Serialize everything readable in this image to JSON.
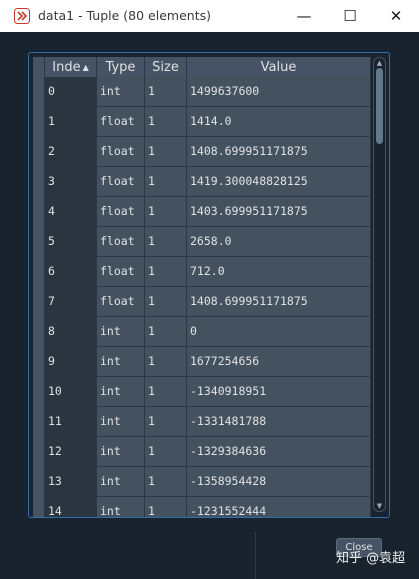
{
  "window": {
    "title": "data1 - Tuple (80 elements)",
    "minimize_glyph": "—",
    "maximize_glyph": "☐",
    "close_glyph": "✕"
  },
  "background_editor": {
    "snippet_lines": [
      "6",
      "汶",
      "i",
      "c",
      "ll"
    ],
    "right_snippet": "ll"
  },
  "table": {
    "headers": {
      "index": "Inde",
      "type": "Type",
      "size": "Size",
      "value": "Value"
    },
    "sort_indicator": "▲",
    "rows": [
      {
        "index": "0",
        "type": "int",
        "size": "1",
        "value": "1499637600"
      },
      {
        "index": "1",
        "type": "float",
        "size": "1",
        "value": "1414.0"
      },
      {
        "index": "2",
        "type": "float",
        "size": "1",
        "value": "1408.699951171875"
      },
      {
        "index": "3",
        "type": "float",
        "size": "1",
        "value": "1419.300048828125"
      },
      {
        "index": "4",
        "type": "float",
        "size": "1",
        "value": "1403.699951171875"
      },
      {
        "index": "5",
        "type": "float",
        "size": "1",
        "value": "2658.0"
      },
      {
        "index": "6",
        "type": "float",
        "size": "1",
        "value": "712.0"
      },
      {
        "index": "7",
        "type": "float",
        "size": "1",
        "value": "1408.699951171875"
      },
      {
        "index": "8",
        "type": "int",
        "size": "1",
        "value": "0"
      },
      {
        "index": "9",
        "type": "int",
        "size": "1",
        "value": "1677254656"
      },
      {
        "index": "10",
        "type": "int",
        "size": "1",
        "value": "-1340918951"
      },
      {
        "index": "11",
        "type": "int",
        "size": "1",
        "value": "-1331481788"
      },
      {
        "index": "12",
        "type": "int",
        "size": "1",
        "value": "-1329384636"
      },
      {
        "index": "13",
        "type": "int",
        "size": "1",
        "value": "-1358954428"
      },
      {
        "index": "14",
        "type": "int",
        "size": "1",
        "value": "-1231552444"
      }
    ]
  },
  "footer": {
    "close_label": "Close"
  },
  "watermark": "知乎 @袁超"
}
